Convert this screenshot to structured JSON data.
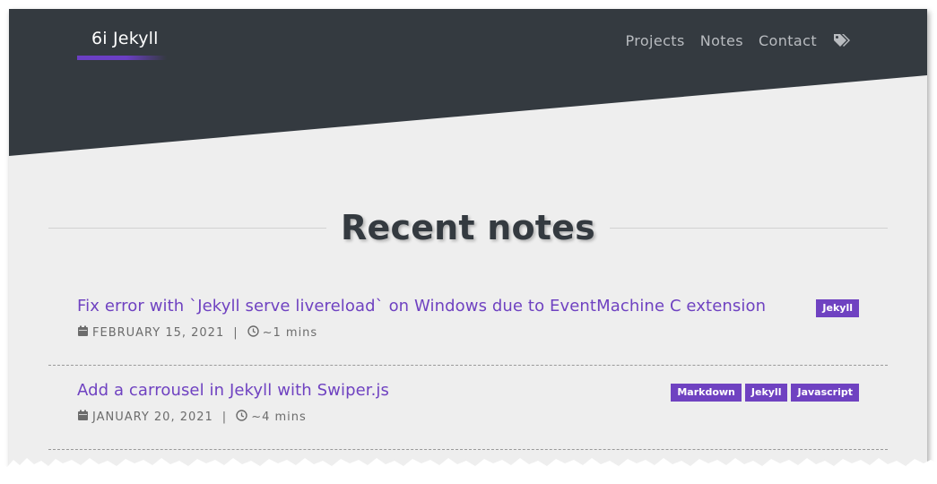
{
  "site": {
    "logo_text": "6i Jekyll"
  },
  "nav": {
    "items": [
      {
        "label": "Projects"
      },
      {
        "label": "Notes"
      },
      {
        "label": "Contact"
      }
    ],
    "tags_icon": "tags-icon"
  },
  "section": {
    "title": "Recent notes"
  },
  "notes": [
    {
      "title": "Fix error with `Jekyll serve livereload` on Windows due to EventMachine C extension",
      "date": "FEBRUARY 15, 2021",
      "separator": "|",
      "read_time": "~1 mins",
      "tags": [
        "Jekyll"
      ]
    },
    {
      "title": "Add a carrousel in Jekyll with Swiper.js",
      "date": "JANUARY 20, 2021",
      "separator": "|",
      "read_time": "~4 mins",
      "tags": [
        "Markdown",
        "Jekyll",
        "Javascript"
      ]
    }
  ],
  "colors": {
    "header_bg": "#343a40",
    "page_bg": "#eeeeee",
    "accent": "#6f42c1",
    "nav_text": "#b9bcc0",
    "heading_text": "#343a40"
  }
}
